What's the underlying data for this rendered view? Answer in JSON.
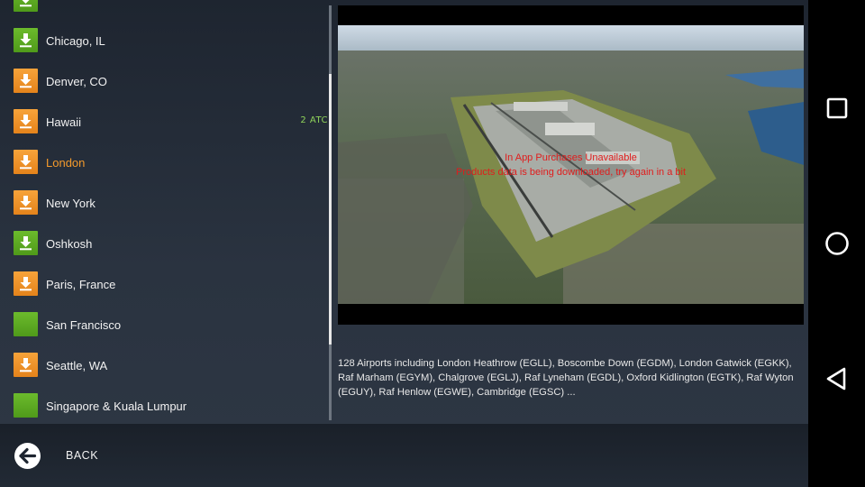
{
  "regions": [
    {
      "label": "",
      "icon": "download-icon",
      "color": "green"
    },
    {
      "label": "Chicago, IL",
      "icon": "download-icon",
      "color": "green"
    },
    {
      "label": "Denver, CO",
      "icon": "download-icon",
      "color": "orange"
    },
    {
      "label": "Hawaii",
      "icon": "download-icon",
      "color": "orange",
      "badge": "2 ATC"
    },
    {
      "label": "London",
      "icon": "download-icon",
      "color": "orange",
      "selected": true
    },
    {
      "label": "New York",
      "icon": "download-icon",
      "color": "orange"
    },
    {
      "label": "Oshkosh",
      "icon": "download-icon",
      "color": "green"
    },
    {
      "label": "Paris, France",
      "icon": "download-icon",
      "color": "orange"
    },
    {
      "label": "San Francisco",
      "icon": "installed-icon",
      "color": "green"
    },
    {
      "label": "Seattle, WA",
      "icon": "download-icon",
      "color": "orange"
    },
    {
      "label": "Singapore & Kuala Lumpur",
      "icon": "installed-icon",
      "color": "green"
    }
  ],
  "preview": {
    "message_line1": "In App Purchases Unavailable",
    "message_line2": "Products data is being downloaded, try again in a bit"
  },
  "description": "128 Airports including London Heathrow (EGLL), Boscombe Down (EGDM), London Gatwick (EGKK), Raf Marham (EGYM), Chalgrove (EGLJ), Raf Lyneham (EGDL), Oxford Kidlington (EGTK), Raf Wyton (EGUY), Raf Henlow (EGWE), Cambridge (EGSC) ...",
  "footer": {
    "back_label": "BACK"
  },
  "android_nav": [
    "recents-icon",
    "home-icon",
    "back-triangle-icon"
  ],
  "colors": {
    "selected_text": "#f39a2c",
    "orange_icon": "#f0941f",
    "green_icon": "#5aa620",
    "error_text": "#e01c1c",
    "atc_badge": "#8fd35a"
  }
}
